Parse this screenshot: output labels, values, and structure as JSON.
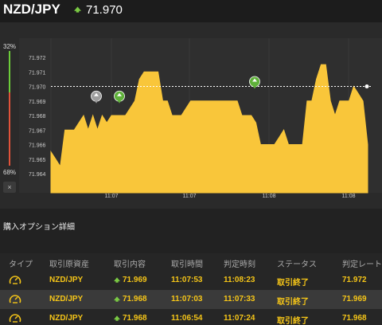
{
  "header": {
    "pair": "NZD/JPY",
    "rate": "71.970",
    "arrow_icon": "up-arrow-icon",
    "arrow_color": "#7ac943"
  },
  "ratio": {
    "high_pct": "32%",
    "low_pct": "68%",
    "close_label": "×",
    "up_color": "#6ccc3a",
    "down_color": "#e0533a"
  },
  "chart_data": {
    "type": "area",
    "title": "",
    "xlabel": "",
    "ylabel": "",
    "ylim": [
      71.963,
      71.9725
    ],
    "y_ticks": [
      "71.972",
      "71.971",
      "71.970",
      "71.969",
      "71.968",
      "71.967",
      "71.966",
      "71.965",
      "71.964"
    ],
    "x_ticks": [
      "11:07",
      "11:07",
      "11:08",
      "11:08"
    ],
    "current_rate_line": 71.97,
    "fill_color": "#f9c63a",
    "series": [
      {
        "values": [
          71.9655,
          71.965,
          71.9645,
          71.967,
          71.967,
          71.967,
          71.9675,
          71.968,
          71.967,
          71.968,
          71.967,
          71.968,
          71.9675,
          71.968,
          71.968,
          71.968,
          71.968,
          71.9685,
          71.969,
          71.9705,
          71.971,
          71.971,
          71.971,
          71.971,
          71.969,
          71.969,
          71.968,
          71.968,
          71.968,
          71.9685,
          71.969,
          71.969,
          71.969,
          71.969,
          71.969,
          71.969,
          71.969,
          71.969,
          71.969,
          71.969,
          71.969,
          71.968,
          71.968,
          71.968,
          71.9675,
          71.966,
          71.966,
          71.966,
          71.966,
          71.9665,
          71.967,
          71.966,
          71.966,
          71.966,
          71.966,
          71.969,
          71.969,
          71.9705,
          71.9715,
          71.9715,
          71.969,
          71.968,
          71.969,
          71.969,
          71.969,
          71.97,
          71.9695,
          71.969,
          71.966
        ]
      }
    ],
    "markers": [
      {
        "type": "entry",
        "rate": 71.969,
        "color": "#9e9e9e"
      },
      {
        "type": "entry",
        "rate": 71.969,
        "color": "#5fb13a"
      },
      {
        "type": "entry",
        "rate": 71.97,
        "color": "#5fb13a"
      }
    ]
  },
  "section": {
    "title": "購入オプション詳細"
  },
  "table": {
    "headers": [
      "タイプ",
      "取引原資産",
      "取引内容",
      "取引時間",
      "判定時刻",
      "ステータス",
      "判定レート"
    ],
    "rows": [
      {
        "asset": "NZD/JPY",
        "content": "71.969",
        "trade_time": "11:07:53",
        "judge_time": "11:08:23",
        "status": "取引終了",
        "judge_rate": "71.972"
      },
      {
        "asset": "NZD/JPY",
        "content": "71.968",
        "trade_time": "11:07:03",
        "judge_time": "11:07:33",
        "status": "取引終了",
        "judge_rate": "71.969"
      },
      {
        "asset": "NZD/JPY",
        "content": "71.968",
        "trade_time": "11:06:54",
        "judge_time": "11:07:24",
        "status": "取引終了",
        "judge_rate": "71.968"
      }
    ],
    "type_icon": "timer-icon",
    "direction_icon": "up-arrow-icon"
  }
}
